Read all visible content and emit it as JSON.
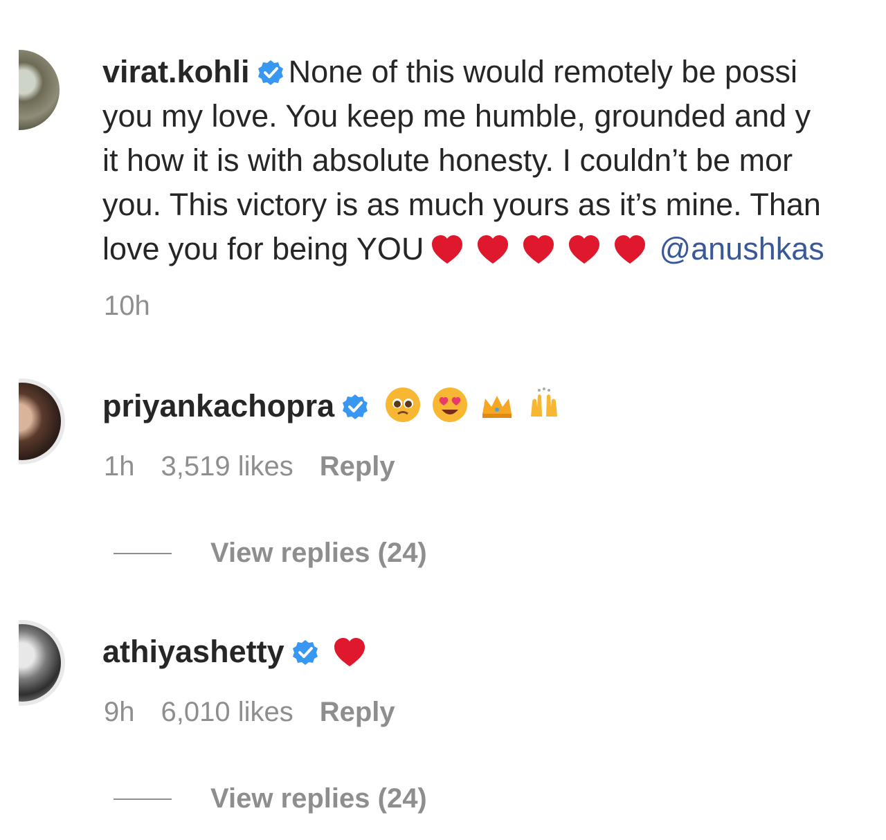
{
  "comments": [
    {
      "username": "virat.kohli",
      "lines": [
        "None of this would remotely be possi",
        "you my love. You keep me humble, grounded and y",
        "it how it is with absolute honesty. I couldn’t be mor",
        "you. This victory is as much yours as it’s mine. Than",
        "love you for being YOU"
      ],
      "mention": "@anushkas",
      "time": "10h"
    },
    {
      "username": "priyankachopra",
      "emojis": [
        "pleading-face",
        "heart-eyes-face",
        "crown",
        "raising-hands"
      ],
      "time": "1h",
      "likes": "3,519 likes",
      "reply": "Reply",
      "view_replies": "View replies (24)"
    },
    {
      "username": "athiyashetty",
      "emojis": [
        "red-heart"
      ],
      "time": "9h",
      "likes": "6,010 likes",
      "reply": "Reply",
      "view_replies": "View replies (24)"
    }
  ],
  "colors": {
    "verified_blue": "#3897f0",
    "heart_red": "#e0182d",
    "mention_blue": "#385898",
    "meta_gray": "#8e8e8e"
  }
}
